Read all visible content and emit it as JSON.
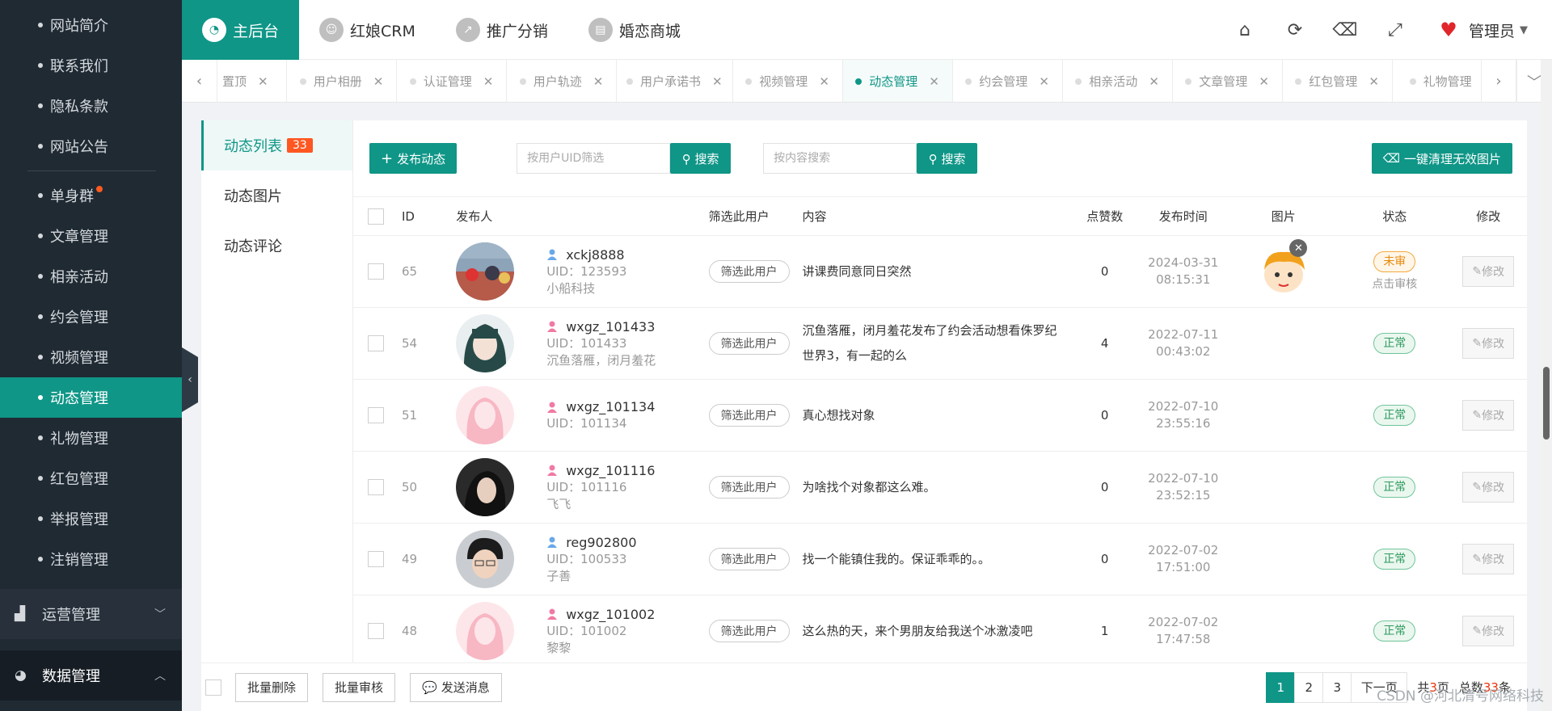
{
  "sidebar": {
    "items_top": [
      {
        "label": "网站简介"
      },
      {
        "label": "联系我们"
      },
      {
        "label": "隐私条款"
      },
      {
        "label": "网站公告"
      }
    ],
    "items": [
      {
        "label": "单身群"
      },
      {
        "label": "文章管理"
      },
      {
        "label": "相亲活动"
      },
      {
        "label": "约会管理"
      },
      {
        "label": "视频管理"
      },
      {
        "label": "动态管理"
      },
      {
        "label": "礼物管理"
      },
      {
        "label": "红包管理"
      },
      {
        "label": "举报管理"
      },
      {
        "label": "注销管理"
      }
    ],
    "group1": {
      "label": "运营管理",
      "icon": "bar-chart-icon"
    },
    "group2": {
      "label": "数据管理",
      "icon": "pie-chart-icon"
    },
    "collapse_icon": "‹"
  },
  "topnav": {
    "items": [
      {
        "label": "主后台"
      },
      {
        "label": "红娘CRM"
      },
      {
        "label": "推广分销"
      },
      {
        "label": "婚恋商城"
      }
    ],
    "admin_label": "管理员"
  },
  "tabs": [
    {
      "label": "置顶"
    },
    {
      "label": "用户相册"
    },
    {
      "label": "认证管理"
    },
    {
      "label": "用户轨迹"
    },
    {
      "label": "用户承诺书"
    },
    {
      "label": "视频管理"
    },
    {
      "label": "动态管理"
    },
    {
      "label": "约会管理"
    },
    {
      "label": "相亲活动"
    },
    {
      "label": "文章管理"
    },
    {
      "label": "红包管理"
    },
    {
      "label": "礼物管理"
    }
  ],
  "subnav": {
    "items": [
      {
        "label": "动态列表",
        "count": "33"
      },
      {
        "label": "动态图片"
      },
      {
        "label": "动态评论"
      }
    ]
  },
  "toolbar": {
    "publish_label": "发布动态",
    "uid_placeholder": "按用户UID筛选",
    "content_placeholder": "按内容搜索",
    "search_label": "搜索",
    "clean_label": "一键清理无效图片"
  },
  "table": {
    "headers": [
      "ID",
      "发布人",
      "筛选此用户",
      "内容",
      "点赞数",
      "发布时间",
      "图片",
      "状态",
      "修改"
    ],
    "filter_label": "筛选此用户",
    "edit_label": "修改",
    "audit_label": "点击审核",
    "rows": [
      {
        "id": "65",
        "name": "xckj8888",
        "uid": "UID：123593",
        "nick": "小船科技",
        "gender": "male",
        "content": "讲课费同意同日突然",
        "likes": "0",
        "date": "2024-03-31",
        "time": "08:15:31",
        "status": "未审",
        "status_type": "pending"
      },
      {
        "id": "54",
        "name": "wxgz_101433",
        "uid": "UID：101433",
        "nick": "沉鱼落雁，闭月羞花",
        "gender": "female",
        "content": "沉鱼落雁，闭月羞花发布了约会活动想看侏罗纪世界3，有一起的么",
        "likes": "4",
        "date": "2022-07-11",
        "time": "00:43:02",
        "status": "正常",
        "status_type": "ok"
      },
      {
        "id": "51",
        "name": "wxgz_101134",
        "uid": "UID：101134",
        "nick": "",
        "gender": "female",
        "content": "真心想找对象",
        "likes": "0",
        "date": "2022-07-10",
        "time": "23:55:16",
        "status": "正常",
        "status_type": "ok"
      },
      {
        "id": "50",
        "name": "wxgz_101116",
        "uid": "UID：101116",
        "nick": "飞飞",
        "gender": "female",
        "content": "为啥找个对象都这么难。",
        "likes": "0",
        "date": "2022-07-10",
        "time": "23:52:15",
        "status": "正常",
        "status_type": "ok"
      },
      {
        "id": "49",
        "name": "reg902800",
        "uid": "UID：100533",
        "nick": "子善",
        "gender": "male",
        "content": "找一个能镇住我的。保证乖乖的。。",
        "likes": "0",
        "date": "2022-07-02",
        "time": "17:51:00",
        "status": "正常",
        "status_type": "ok"
      },
      {
        "id": "48",
        "name": "wxgz_101002",
        "uid": "UID：101002",
        "nick": "黎黎",
        "gender": "female",
        "content": "这么热的天，来个男朋友给我送个冰激凌吧",
        "likes": "1",
        "date": "2022-07-02",
        "time": "17:47:58",
        "status": "正常",
        "status_type": "ok"
      }
    ]
  },
  "footer": {
    "batch_delete": "批量删除",
    "batch_audit": "批量审核",
    "send_message": "发送消息",
    "pages": [
      "1",
      "2",
      "3"
    ],
    "next": "下一页",
    "total_pages_prefix": "共",
    "total_pages": "3",
    "total_pages_suffix": "页",
    "total_prefix": "总数",
    "total": "33",
    "total_suffix": "条"
  },
  "watermark": "CSDN @河北清号网络科技",
  "colors": {
    "accent": "#0f9687",
    "sidebar": "#202a33",
    "badge": "#ff5722",
    "pending": "#e8890c",
    "ok": "#2e9a5d"
  }
}
